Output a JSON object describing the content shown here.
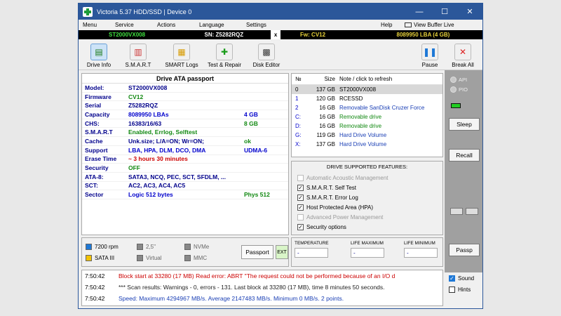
{
  "window": {
    "title": "Victoria 5.37 HDD/SSD | Device 0",
    "controls": [
      "—",
      "☐",
      "✕"
    ]
  },
  "menu": {
    "items": [
      "Menu",
      "Service",
      "Actions",
      "Language",
      "Settings",
      "Help"
    ],
    "view_buffer": "View Buffer Live"
  },
  "device_bar": {
    "model": "ST2000VX008",
    "sn": "SN: Z5282RQZ",
    "close": "x",
    "fw": "Fw: CV12",
    "lba": "8089950 LBA (4 GB)"
  },
  "toolbar": {
    "drive_info": "Drive Info",
    "smart": "S.M.A.R.T",
    "smart_logs": "SMART Logs",
    "test_repair": "Test & Repair",
    "disk_editor": "Disk Editor",
    "pause": "Pause",
    "break_all": "Break All"
  },
  "passport": {
    "title": "Drive ATA passport",
    "rows": [
      {
        "k": "Model:",
        "v": "ST2000VX008",
        "x": ""
      },
      {
        "k": "Firmware",
        "v": "CV12",
        "x": ""
      },
      {
        "k": "Serial",
        "v": "Z5282RQZ",
        "x": ""
      },
      {
        "k": "Capacity",
        "v": "8089950 LBAs",
        "x": "4 GB"
      },
      {
        "k": "CHS:",
        "v": "16383/16/63",
        "x": "8 GB"
      },
      {
        "k": "S.M.A.R.T",
        "v": "Enabled, Errlog, Selftest",
        "x": ""
      },
      {
        "k": "Cache",
        "v": "Unk.size; L/A=ON; Wr=ON;",
        "x": "ok"
      },
      {
        "k": "Support",
        "v": "LBA, HPA, DLM, DCO, DMA",
        "x": "UDMA-6"
      },
      {
        "k": "Erase Time",
        "v": "~ 3 hours 30 minutes",
        "x": ""
      },
      {
        "k": "Security",
        "v": "OFF",
        "x": ""
      },
      {
        "k": "ATA-8:",
        "v": "SATA3, NCQ, PEC, SCT, SFDLM, ...",
        "x": ""
      },
      {
        "k": "SCT:",
        "v": "AC2, AC3, AC4, AC5",
        "x": ""
      },
      {
        "k": "Sector",
        "v": "Logic 512 bytes",
        "x": "Phys 512"
      }
    ]
  },
  "device_list": {
    "headers": {
      "n": "№",
      "size": "Size",
      "note": "Note / click to refresh"
    },
    "rows": [
      {
        "n": "0",
        "size": "137 GB",
        "note": "ST2000VX008"
      },
      {
        "n": "1",
        "size": "120 GB",
        "note": "RCESSD"
      },
      {
        "n": "2",
        "size": "16 GB",
        "note": "Removable SanDisk Cruzer Force"
      },
      {
        "n": "C:",
        "size": "16 GB",
        "note": "Removable drive"
      },
      {
        "n": "D:",
        "size": "16 GB",
        "note": "Removable drive"
      },
      {
        "n": "G:",
        "size": "119 GB",
        "note": "Hard Drive Volume"
      },
      {
        "n": "X:",
        "size": "137 GB",
        "note": "Hard Drive Volume"
      }
    ]
  },
  "features": {
    "title": "DRIVE SUPPORTED FEATURES:",
    "items": [
      {
        "label": "Automatic Acoustic Management",
        "checked": false,
        "enabled": false
      },
      {
        "label": "S.M.A.R.T. Self Test",
        "checked": true,
        "enabled": true
      },
      {
        "label": "S.M.A.R.T. Error Log",
        "checked": true,
        "enabled": true
      },
      {
        "label": "Host Protected Area (HPA)",
        "checked": true,
        "enabled": true
      },
      {
        "label": "Advanced Power Management",
        "checked": false,
        "enabled": false
      },
      {
        "label": "Security options",
        "checked": true,
        "enabled": true
      }
    ]
  },
  "drive_type": {
    "rpm": "7200 rpm",
    "form": "2,5\"",
    "nvme": "NVMe",
    "sata": "SATA III",
    "virtual": "Virtual",
    "mmc": "MMC",
    "passport_btn": "Passport",
    "ext_btn": "EXT",
    "colors": {
      "rpm": "#1e78d6",
      "sata": "#f2c200",
      "gray": "#888888"
    }
  },
  "temperature": {
    "temp_label": "TEMPERATURE",
    "temp_value": "-",
    "life_max_label": "LIFE MAXIMUM",
    "life_max_value": "-",
    "life_min_label": "LIFE MINIMUM",
    "life_min_value": "-"
  },
  "log": [
    {
      "time": "7:50:42",
      "msg": "Block start at 33280 (17 MB) Read error: ABRT \"The request could not be performed because of an I/O d",
      "color": "#cc0000"
    },
    {
      "time": "7:50:42",
      "msg": "*** Scan results: Warnings - 0, errors - 131. Last block at 33280 (17 MB), time 8 minutes 50 seconds.",
      "color": "#222222"
    },
    {
      "time": "7:50:42",
      "msg": "Speed: Maximum 4294967 MB/s. Average 2147483 MB/s. Minimum 0 MB/s. 2 points.",
      "color": "#1a3fb5"
    }
  ],
  "side": {
    "api": "API",
    "pio": "PIO",
    "sleep": "Sleep",
    "recall": "Recall",
    "passp": "Passp",
    "sound": "Sound",
    "hints": "Hints",
    "sound_checked": true,
    "hints_checked": false
  }
}
